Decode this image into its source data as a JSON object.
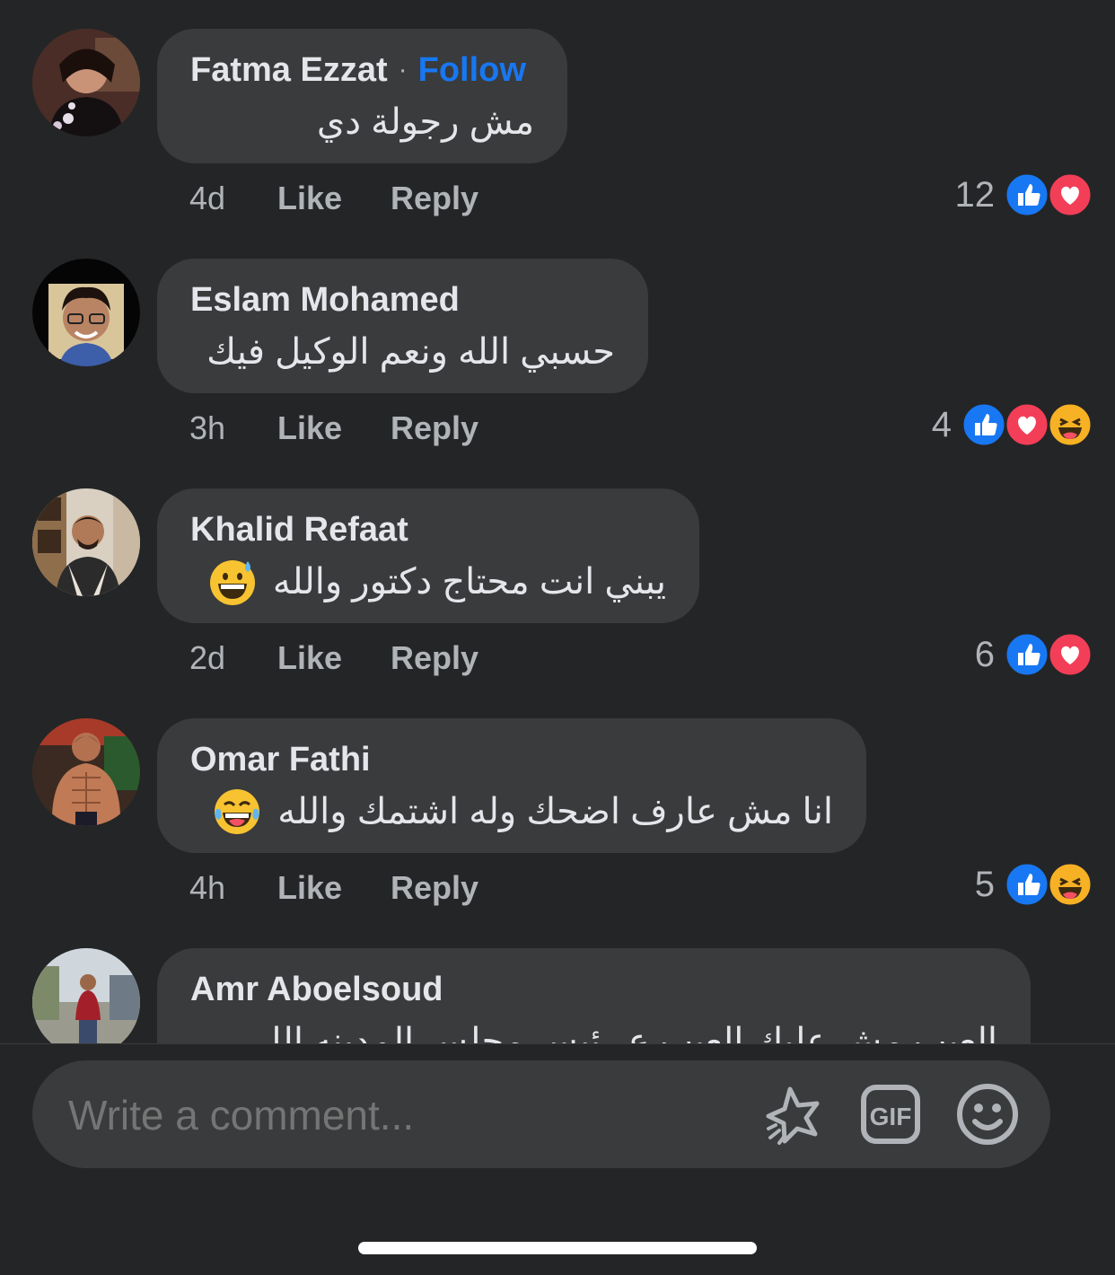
{
  "comments": [
    {
      "name": "Fatma Ezzat",
      "follow": "Follow",
      "text": "مش رجولة دي",
      "time": "4d",
      "like": "Like",
      "reply": "Reply",
      "reaction_count": "12"
    },
    {
      "name": "Eslam Mohamed",
      "text": "حسبي الله ونعم الوكيل فيك",
      "time": "3h",
      "like": "Like",
      "reply": "Reply",
      "reaction_count": "4"
    },
    {
      "name": "Khalid Refaat",
      "text": "يبني انت محتاج دكتور والله",
      "time": "2d",
      "like": "Like",
      "reply": "Reply",
      "reaction_count": "6"
    },
    {
      "name": "Omar Fathi",
      "text": "انا مش عارف اضحك وله اشتمك والله",
      "time": "4h",
      "like": "Like",
      "reply": "Reply",
      "reaction_count": "5"
    },
    {
      "name": "Amr Aboelsoud",
      "text": "العيب مش عليك العيب ع رئيس مجلس المدينه اللي"
    }
  ],
  "composer": {
    "placeholder": "Write a comment..."
  },
  "icons": {
    "like": "like-reaction-icon",
    "love": "love-reaction-icon",
    "haha": "haha-reaction-icon",
    "sweat_smile": "grinning-sweat-emoji",
    "tears_of_joy": "tears-of-joy-emoji",
    "sticker": "sticker-icon",
    "gif": "gif-icon",
    "emoji": "emoji-icon"
  },
  "colors": {
    "background": "#242526",
    "bubble": "#3a3b3c",
    "follow": "#1877f2",
    "like": "#1877f2",
    "love": "#f33e58"
  }
}
